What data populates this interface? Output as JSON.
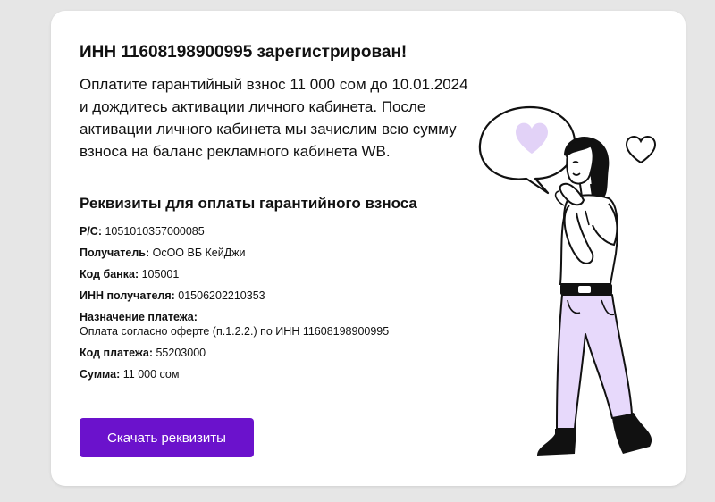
{
  "notice": {
    "title": "ИНН 11608198900995 зарегистрирован!",
    "text": "Оплатите гарантийный взнос 11 000 сом до 10.01.2024 и дождитесь активации личного кабинета. После активации личного кабинета мы зачислим всю сумму взноса на баланс рекламного кабинета WB."
  },
  "requisites": {
    "heading": "Реквизиты для оплаты гарантийного взноса",
    "rs": {
      "label": "Р/С:",
      "value": "1051010357000085"
    },
    "recipient": {
      "label": "Получатель:",
      "value": "ОсОО ВБ КейДжи"
    },
    "bank_code": {
      "label": "Код банка:",
      "value": "105001"
    },
    "recipient_inn": {
      "label": "ИНН получателя:",
      "value": "01506202210353"
    },
    "purpose": {
      "label": "Назначение платежа:",
      "value": "Оплата согласно оферте (п.1.2.2.) по ИНН 11608198900995"
    },
    "payment_code": {
      "label": "Код платежа:",
      "value": "55203000"
    },
    "amount": {
      "label": "Сумма:",
      "value": "11 000 сом"
    }
  },
  "actions": {
    "download_label": "Скачать реквизиты"
  },
  "colors": {
    "accent": "#6b12cc",
    "illustration_lavender": "#e7d9fb"
  }
}
